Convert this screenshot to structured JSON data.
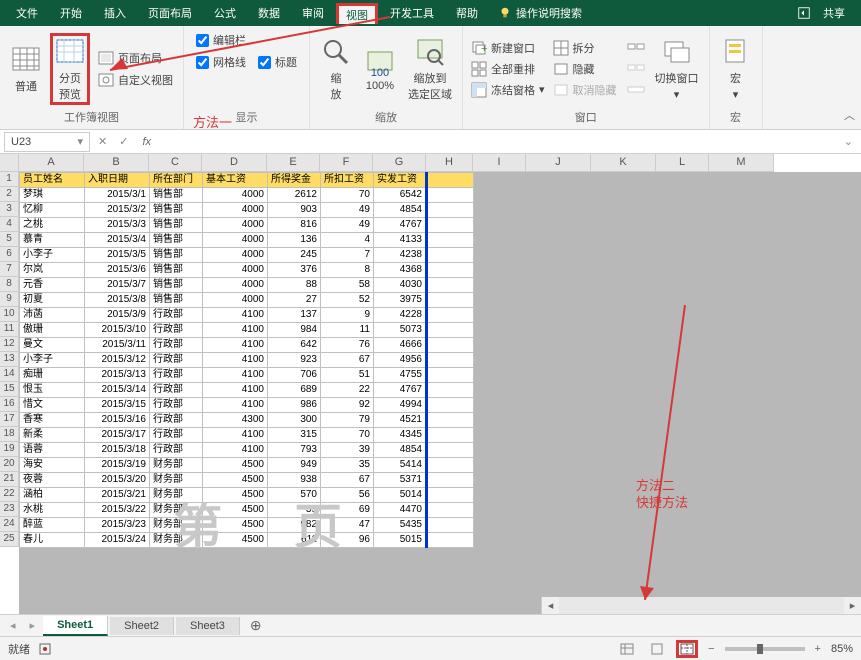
{
  "menubar": {
    "tabs": [
      "文件",
      "开始",
      "插入",
      "页面布局",
      "公式",
      "数据",
      "审阅",
      "视图",
      "开发工具",
      "帮助"
    ],
    "active": "视图",
    "help_text": "操作说明搜索",
    "share": "共享"
  },
  "ribbon": {
    "views": {
      "normal": "普通",
      "page_break": "分页\n预览",
      "layout": "页面布局",
      "custom": "自定义视图",
      "group_label": "工作簿视图"
    },
    "show": {
      "formula_bar": "编辑栏",
      "gridlines": "网格线",
      "headings": "标题",
      "group_label": "显示"
    },
    "zoom": {
      "zoom": "缩\n放",
      "hundred": "100%",
      "selection": "缩放到\n选定区域",
      "group_label": "缩放"
    },
    "window": {
      "new_win": "新建窗口",
      "arrange": "全部重排",
      "freeze": "冻结窗格",
      "split": "拆分",
      "hide": "隐藏",
      "unhide": "取消隐藏",
      "switch": "切换窗口",
      "group_label": "窗口"
    },
    "macros": {
      "label": "宏",
      "group_label": "宏"
    }
  },
  "formula_bar": {
    "namebox": "U23",
    "fx": "fx"
  },
  "columns": [
    {
      "name": "A",
      "w": 65
    },
    {
      "name": "B",
      "w": 65
    },
    {
      "name": "C",
      "w": 53
    },
    {
      "name": "D",
      "w": 65
    },
    {
      "name": "E",
      "w": 53
    },
    {
      "name": "F",
      "w": 53
    },
    {
      "name": "G",
      "w": 53
    },
    {
      "name": "H",
      "w": 47
    },
    {
      "name": "I",
      "w": 53
    },
    {
      "name": "J",
      "w": 65
    },
    {
      "name": "K",
      "w": 65
    },
    {
      "name": "L",
      "w": 53
    },
    {
      "name": "M",
      "w": 65
    }
  ],
  "grid": {
    "header": [
      "员工姓名",
      "入职日期",
      "所在部门",
      "基本工资",
      "所得奖金",
      "所扣工资",
      "实发工资"
    ],
    "rows": [
      [
        "梦琪",
        "2015/3/1",
        "销售部",
        "4000",
        "2612",
        "70",
        "6542"
      ],
      [
        "忆柳",
        "2015/3/2",
        "销售部",
        "4000",
        "903",
        "49",
        "4854"
      ],
      [
        "之桃",
        "2015/3/3",
        "销售部",
        "4000",
        "816",
        "49",
        "4767"
      ],
      [
        "慕青",
        "2015/3/4",
        "销售部",
        "4000",
        "136",
        "4",
        "4133"
      ],
      [
        "小李子",
        "2015/3/5",
        "销售部",
        "4000",
        "245",
        "7",
        "4238"
      ],
      [
        "尔岚",
        "2015/3/6",
        "销售部",
        "4000",
        "376",
        "8",
        "4368"
      ],
      [
        "元香",
        "2015/3/7",
        "销售部",
        "4000",
        "88",
        "58",
        "4030"
      ],
      [
        "初夏",
        "2015/3/8",
        "销售部",
        "4000",
        "27",
        "52",
        "3975"
      ],
      [
        "沛菡",
        "2015/3/9",
        "行政部",
        "4100",
        "137",
        "9",
        "4228"
      ],
      [
        "傲珊",
        "2015/3/10",
        "行政部",
        "4100",
        "984",
        "11",
        "5073"
      ],
      [
        "曼文",
        "2015/3/11",
        "行政部",
        "4100",
        "642",
        "76",
        "4666"
      ],
      [
        "小李子",
        "2015/3/12",
        "行政部",
        "4100",
        "923",
        "67",
        "4956"
      ],
      [
        "痴珊",
        "2015/3/13",
        "行政部",
        "4100",
        "706",
        "51",
        "4755"
      ],
      [
        "恨玉",
        "2015/3/14",
        "行政部",
        "4100",
        "689",
        "22",
        "4767"
      ],
      [
        "惜文",
        "2015/3/15",
        "行政部",
        "4100",
        "986",
        "92",
        "4994"
      ],
      [
        "香寒",
        "2015/3/16",
        "行政部",
        "4300",
        "300",
        "79",
        "4521"
      ],
      [
        "新柔",
        "2015/3/17",
        "行政部",
        "4100",
        "315",
        "70",
        "4345"
      ],
      [
        "语蓉",
        "2015/3/18",
        "行政部",
        "4100",
        "793",
        "39",
        "4854"
      ],
      [
        "海安",
        "2015/3/19",
        "财务部",
        "4500",
        "949",
        "35",
        "5414"
      ],
      [
        "夜蓉",
        "2015/3/20",
        "财务部",
        "4500",
        "938",
        "67",
        "5371"
      ],
      [
        "涵柏",
        "2015/3/21",
        "财务部",
        "4500",
        "570",
        "56",
        "5014"
      ],
      [
        "水桃",
        "2015/3/22",
        "财务部",
        "4500",
        "39",
        "69",
        "4470"
      ],
      [
        "醉蓝",
        "2015/3/23",
        "财务部",
        "4500",
        "982",
        "47",
        "5435"
      ],
      [
        "春儿",
        "2015/3/24",
        "财务部",
        "4500",
        "611",
        "96",
        "5015"
      ]
    ],
    "watermark": "第 页"
  },
  "tabs": {
    "sheets": [
      "Sheet1",
      "Sheet2",
      "Sheet3"
    ],
    "active": "Sheet1"
  },
  "statusbar": {
    "status": "就绪",
    "zoom": "85%"
  },
  "annotations": {
    "method1": "方法一",
    "method2_a": "方法二",
    "method2_b": "快捷方法"
  }
}
